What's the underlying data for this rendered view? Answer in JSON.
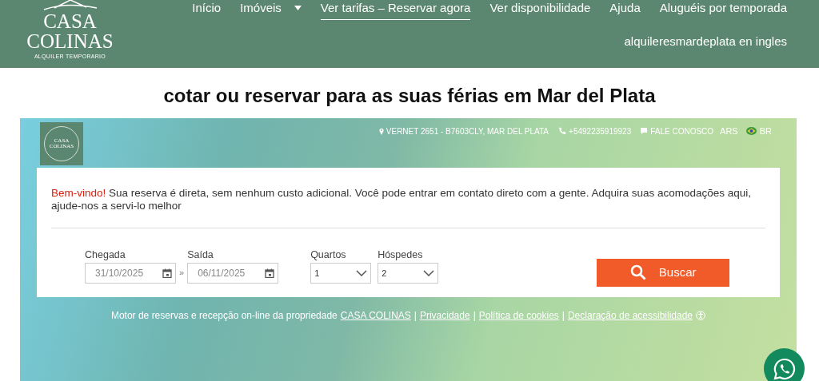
{
  "header": {
    "logo": {
      "line1": "CASA",
      "line2": "COLINAS",
      "tagline": "ALQUILER TEMPORARIO"
    },
    "nav": [
      {
        "label": "Início",
        "selected": false,
        "dropdown": false
      },
      {
        "label": "Imóveis",
        "selected": false,
        "dropdown": true
      },
      {
        "label": "Ver tarifas – Reservar agora",
        "selected": true,
        "dropdown": false
      },
      {
        "label": "Ver disponibilidade",
        "selected": false,
        "dropdown": false
      },
      {
        "label": "Ajuda",
        "selected": false,
        "dropdown": false
      },
      {
        "label": "Aluguéis por temporada",
        "selected": false,
        "dropdown": false
      },
      {
        "label": "alquileresmardeplata en ingles",
        "selected": false,
        "dropdown": false
      }
    ]
  },
  "heading": "cotar ou reservar para as suas férias em Mar del Plata",
  "booking": {
    "mini_logo": {
      "line1": "CASA",
      "line2": "COLINAS"
    },
    "topbar": {
      "address": "VERNET 2651 - B7603CLY, MAR DEL PLATA",
      "phone": "+5492235919923",
      "contact": "FALE CONOSCO",
      "currency": "ARS",
      "language": "BR"
    },
    "welcome": {
      "greeting": "Bem-vindo!",
      "text": "Sua reserva é direta, sem nenhum custo adicional. Você pode entrar em contato direto com a gente. Adquira suas acomodações aqui, ajude-nos a servi-lo melhor"
    },
    "arrival": {
      "label": "Chegada",
      "value": "31/10/2025"
    },
    "separator": "»",
    "departure": {
      "label": "Saída",
      "value": "06/11/2025"
    },
    "rooms": {
      "label": "Quartos",
      "value": "1"
    },
    "guests": {
      "label": "Hóspedes",
      "value": "2"
    },
    "search_button": "Buscar",
    "footer": {
      "text": "Motor de reservas e recepção on-line da propriedade",
      "links": [
        "CASA COLINAS",
        "Privacidade",
        "Política de cookies",
        "Declaração de acessibilidade"
      ],
      "separator": "|"
    }
  }
}
